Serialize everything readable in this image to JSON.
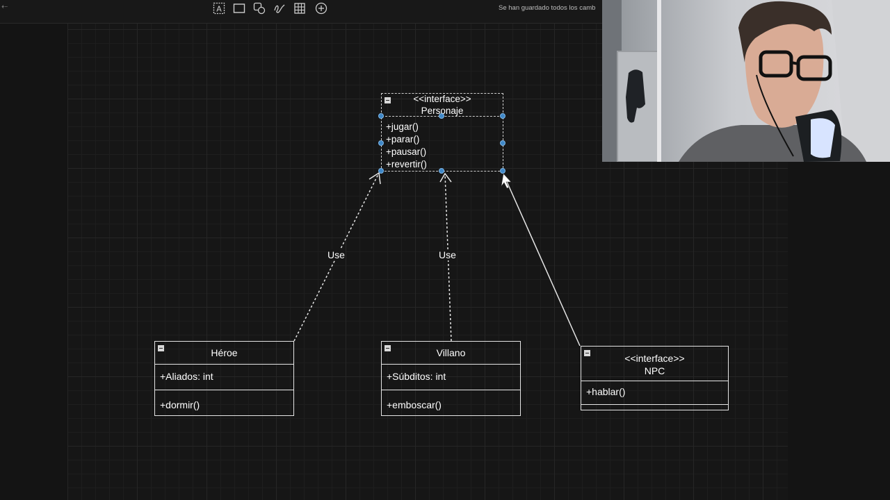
{
  "toolbar": {
    "tools": [
      {
        "icon": "text-tool-icon"
      },
      {
        "icon": "rectangle-tool-icon"
      },
      {
        "icon": "shapes-tool-icon"
      },
      {
        "icon": "freehand-tool-icon"
      },
      {
        "icon": "table-tool-icon"
      },
      {
        "icon": "add-icon"
      }
    ],
    "save_status": "Se han guardado todos los camb"
  },
  "diagram": {
    "personaje": {
      "stereotype": "<<interface>>",
      "name": "Personaje",
      "methods": [
        "+jugar()",
        "+parar()",
        "+pausar()",
        "+revertir()"
      ]
    },
    "heroe": {
      "name": "Héroe",
      "attributes": [
        "+Aliados: int"
      ],
      "methods": [
        "+dormir()"
      ]
    },
    "villano": {
      "name": "Villano",
      "attributes": [
        "+Súbditos: int"
      ],
      "methods": [
        "+emboscar()"
      ]
    },
    "npc": {
      "stereotype": "<<interface>>",
      "name": "NPC",
      "methods": [
        "+hablar()"
      ]
    },
    "edges": {
      "heroe_label": "Use",
      "villano_label": "Use"
    }
  },
  "colors": {
    "background": "#151515",
    "grid": "#262626",
    "stroke": "#e6e6e6",
    "selection": "#3f88c8"
  }
}
